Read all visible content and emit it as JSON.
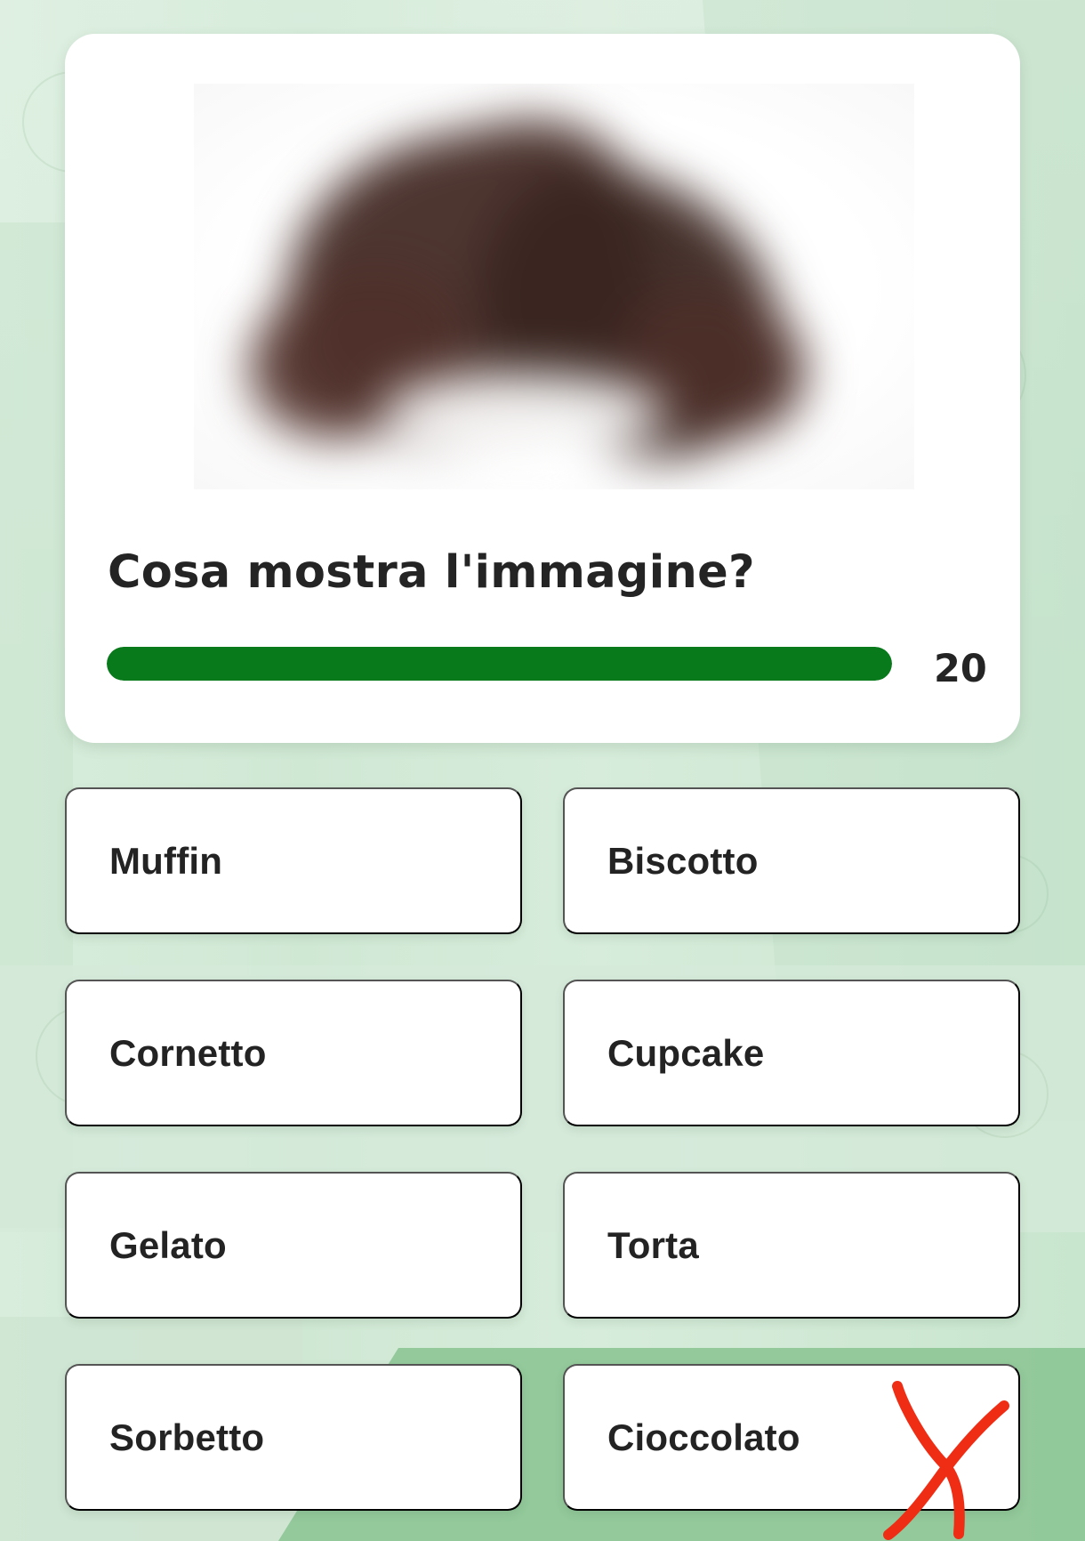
{
  "quiz": {
    "question": "Cosa mostra l'immagine?",
    "timer": {
      "value": "20",
      "fill_fraction": 1.0
    },
    "answers": [
      {
        "label": "Muffin"
      },
      {
        "label": "Biscotto"
      },
      {
        "label": "Cornetto"
      },
      {
        "label": "Cupcake"
      },
      {
        "label": "Gelato"
      },
      {
        "label": "Torta"
      },
      {
        "label": "Sorbetto"
      },
      {
        "label": "Cioccolato"
      }
    ]
  },
  "colors": {
    "timer_green": "#087a1b",
    "wrong_mark_red": "#ef2d15",
    "background_green": "#dcefdf"
  },
  "icons": {
    "wrong_mark": "x-mark-icon"
  }
}
